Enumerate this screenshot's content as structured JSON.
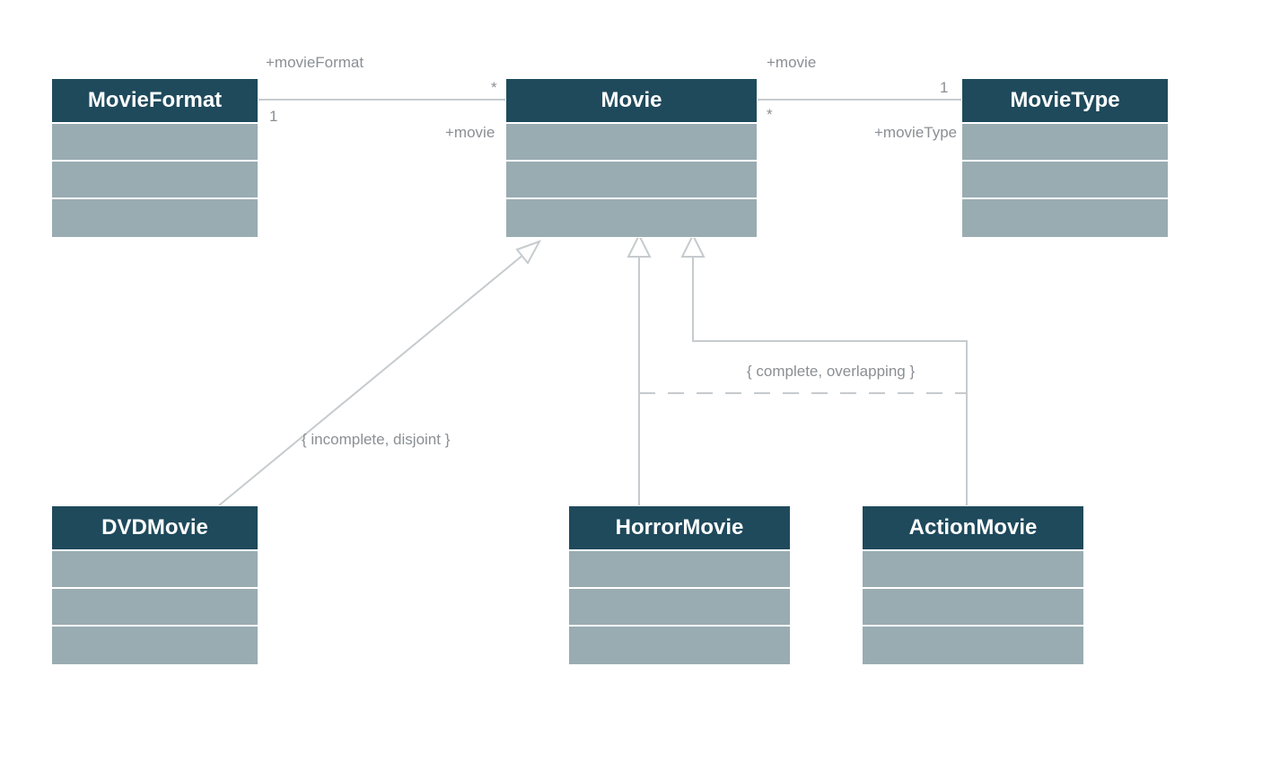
{
  "diagram": {
    "classes": {
      "movieFormat": {
        "name": "MovieFormat"
      },
      "movie": {
        "name": "Movie"
      },
      "movieType": {
        "name": "MovieType"
      },
      "dvdMovie": {
        "name": "DVDMovie"
      },
      "horrorMovie": {
        "name": "HorrorMovie"
      },
      "actionMovie": {
        "name": "ActionMovie"
      }
    },
    "associations": {
      "movieFormat_movie": {
        "endA": {
          "role": "+movieFormat",
          "multiplicity": "*"
        },
        "endB": {
          "role": "+movie",
          "multiplicity": "1"
        }
      },
      "movie_movieType": {
        "endA": {
          "role": "+movie",
          "multiplicity": "1"
        },
        "endB": {
          "role": "+movieType",
          "multiplicity": "*"
        }
      }
    },
    "generalizations": {
      "dvd_set": {
        "constraint": "{ incomplete, disjoint }"
      },
      "genre_set": {
        "constraint": "{ complete, overlapping }"
      }
    }
  }
}
